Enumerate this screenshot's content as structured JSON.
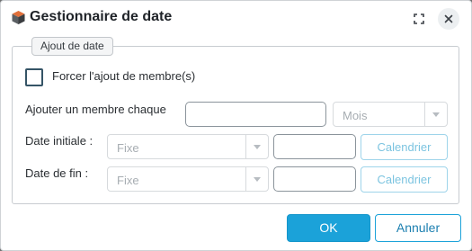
{
  "dialog": {
    "title": "Gestionnaire de date",
    "icons": {
      "app": "app-cube-icon",
      "expand": "expand-icon",
      "close": "close-icon"
    }
  },
  "fieldset": {
    "legend": "Ajout de date",
    "force_checkbox": {
      "label": "Forcer l'ajout de membre(s)",
      "checked": false
    },
    "each": {
      "label": "Ajouter un membre chaque",
      "value": "",
      "unit": "Mois"
    },
    "start": {
      "label": "Date initiale :",
      "type": "Fixe",
      "value": "",
      "button": "Calendrier"
    },
    "end": {
      "label": "Date de fin :",
      "type": "Fixe",
      "value": "",
      "button": "Calendrier"
    }
  },
  "footer": {
    "ok": "OK",
    "cancel": "Annuler"
  },
  "colors": {
    "primary": "#1ba2d9",
    "disabled_text": "#a7adb2",
    "calendar_text": "#7cc4e0"
  }
}
